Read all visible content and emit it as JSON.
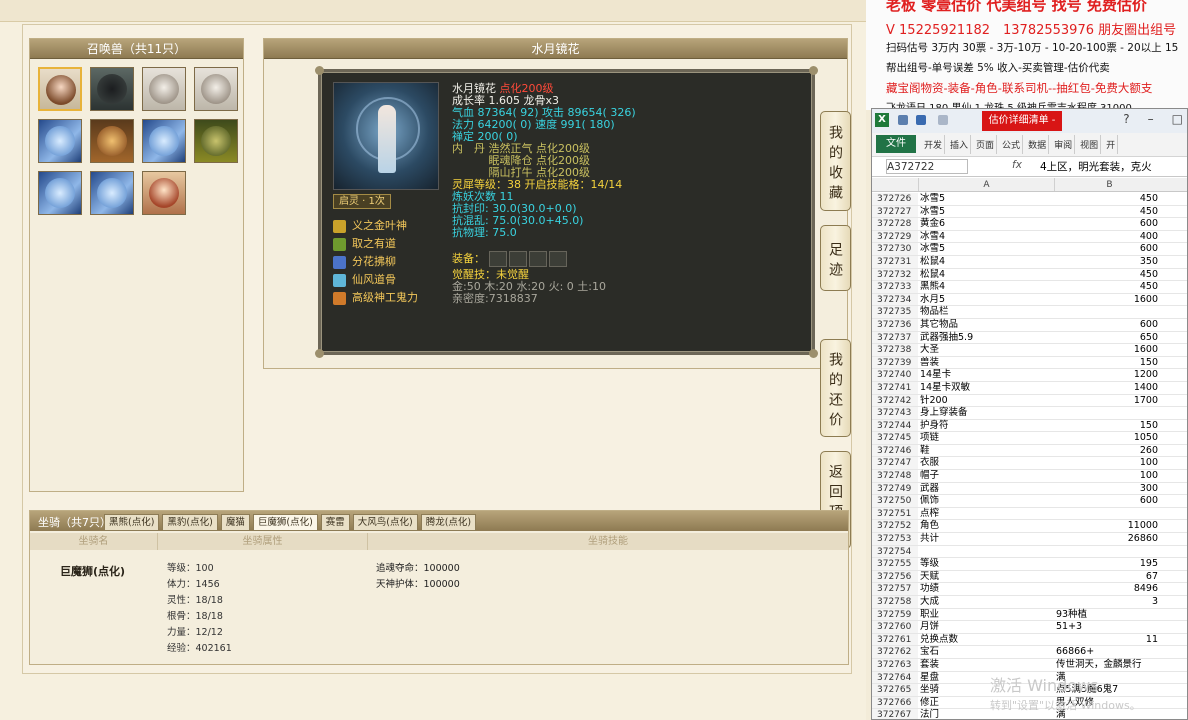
{
  "summon": {
    "title": "召唤兽（共11只）",
    "pets": [
      {
        "kind": "girl"
      },
      {
        "kind": "dark"
      },
      {
        "kind": "rat"
      },
      {
        "kind": "rat"
      },
      {
        "kind": "ice"
      },
      {
        "kind": "monkey"
      },
      {
        "kind": "ice"
      },
      {
        "kind": "green"
      },
      {
        "kind": "ice"
      },
      {
        "kind": "ice"
      },
      {
        "kind": "lady"
      }
    ]
  },
  "detail": {
    "title": "水月镜花",
    "name": "水月镜花",
    "name_tag": "点化200级",
    "growth": "成长率 1.605 龙骨x3",
    "hp": "气血 87364( 92) 攻击 89654( 326)",
    "mp": "法力 64200( 0) 速度 991( 180)",
    "zen": "禅定 200( 0)",
    "dan1": "内　丹 浩然正气 点化200级",
    "dan2": "　　　 眠魂降仓 点化200级",
    "dan3": "　　　 隔山打牛 点化200级",
    "spirit": "灵犀等级：38 开启技能格：14/14",
    "refine": "炼妖次数 11",
    "res1": "抗封印: 30.0(30.0+0.0)",
    "res2": "抗混乱: 75.0(30.0+45.0)",
    "res3": "抗物理: 75.0",
    "equip_label": "装备：",
    "awaken": "觉醒技：未觉醒",
    "elements": "金:50 木:20 水:20 火: 0 土:10",
    "intimacy": "亲密度:7318837",
    "spirit_tag": "启灵 · 1次",
    "skills": [
      "义之金叶神",
      "取之有道",
      "分花拂柳",
      "仙风道骨",
      "高级神工鬼力"
    ]
  },
  "side_buttons": [
    "我的收藏",
    "足迹",
    "我的还价",
    "返回顶部"
  ],
  "mount": {
    "title": "坐骑（共7只）",
    "tabs": [
      "黑熊(点化)",
      "黑豹(点化)",
      "魔猫",
      "巨魔狮(点化)",
      "赛雷",
      "大风鸟(点化)",
      "腾龙(点化)"
    ],
    "active_tab": 3,
    "columns": [
      "坐骑名",
      "坐骑属性",
      "坐骑技能"
    ],
    "name": "巨魔狮(点化)",
    "attrs": [
      "等级：100",
      "体力：1456",
      "灵性：18/18",
      "根骨：18/18",
      "力量：12/12",
      "经验：402161"
    ],
    "skills": [
      "追魂夺命：100000",
      "天神护体：100000"
    ]
  },
  "ad": {
    "line1": "老板 零壹估价 代美组号 找号 免费估价",
    "line2": "V 15225921182　13782553976 朋友圈出组号",
    "line3": "扫码估号 3万内 30票 - 3万-10万 - 10-20-100票 - 20以上 15",
    "line4": "帮出组号-单号误差 5% 收入-买卖管理-估价代卖",
    "line5": "藏宝阁物资-装备-角色-联系司机--抽红包-免费大额支",
    "line6": "飞龙语日 180 男仙 1 龙珠 5 级神兵雷吉水程度 31000"
  },
  "excel": {
    "title": "估价详细清单 - M...",
    "file_tab": "文件",
    "ribbon_tabs": [
      "开发",
      "插入",
      "页面",
      "公式",
      "数据",
      "审阅",
      "视图",
      "开"
    ],
    "name_box": "A372722",
    "fx": "fx",
    "formula": "4上区，明光套装，克火",
    "col_a": "A",
    "col_b": "B",
    "rows": [
      [
        "372726",
        "冰雪5",
        "450"
      ],
      [
        "372727",
        "冰雪5",
        "450"
      ],
      [
        "372728",
        "黄金6",
        "600"
      ],
      [
        "372729",
        "冰雪4",
        "400"
      ],
      [
        "372730",
        "冰雪5",
        "600"
      ],
      [
        "372731",
        "松鼠4",
        "350"
      ],
      [
        "372732",
        "松鼠4",
        "450"
      ],
      [
        "372733",
        "黑熊4",
        "450"
      ],
      [
        "372734",
        "水月5",
        "1600"
      ],
      [
        "372735",
        "物品栏",
        ""
      ],
      [
        "372736",
        "其它物品",
        "600"
      ],
      [
        "372737",
        "武器强抽5.9",
        "650"
      ],
      [
        "372738",
        "大圣",
        "1600"
      ],
      [
        "372739",
        "兽装",
        "150"
      ],
      [
        "372740",
        "14星卡",
        "1200"
      ],
      [
        "372741",
        "14星卡双敏",
        "1400"
      ],
      [
        "372742",
        "针200",
        "1700"
      ],
      [
        "372743",
        "身上穿装备",
        ""
      ],
      [
        "372744",
        "护身符",
        "150"
      ],
      [
        "372745",
        "项链",
        "1050"
      ],
      [
        "372746",
        "鞋",
        "260"
      ],
      [
        "372747",
        "衣服",
        "100"
      ],
      [
        "372748",
        "帽子",
        "100"
      ],
      [
        "372749",
        "武器",
        "300"
      ],
      [
        "372750",
        "佩饰",
        "600"
      ],
      [
        "372751",
        "点榨",
        ""
      ],
      [
        "372752",
        "角色",
        "11000"
      ],
      [
        "372753",
        "共计",
        "26860"
      ],
      [
        "372754",
        "",
        ""
      ],
      [
        "372755",
        "等级",
        "195"
      ],
      [
        "372756",
        "天赋",
        "67"
      ],
      [
        "372757",
        "功绩",
        "8496"
      ],
      [
        "372758",
        "大成",
        "3"
      ],
      [
        "372759",
        "职业",
        "93种植"
      ],
      [
        "372760",
        "月饼",
        "51+3"
      ],
      [
        "372761",
        "兑换点数",
        "11"
      ],
      [
        "372762",
        "宝石",
        "66866+"
      ],
      [
        "372763",
        "套装",
        "传世洞天，金麟景行"
      ],
      [
        "372764",
        "星盘",
        "满"
      ],
      [
        "372765",
        "坐骑",
        "点5满5魔6鬼7"
      ],
      [
        "372766",
        "修正",
        "男人双修"
      ],
      [
        "372767",
        "法门",
        "满"
      ]
    ]
  },
  "watermark": {
    "line1": "激活 Windows",
    "line2": "转到\"设置\"以激活 Windows。"
  }
}
